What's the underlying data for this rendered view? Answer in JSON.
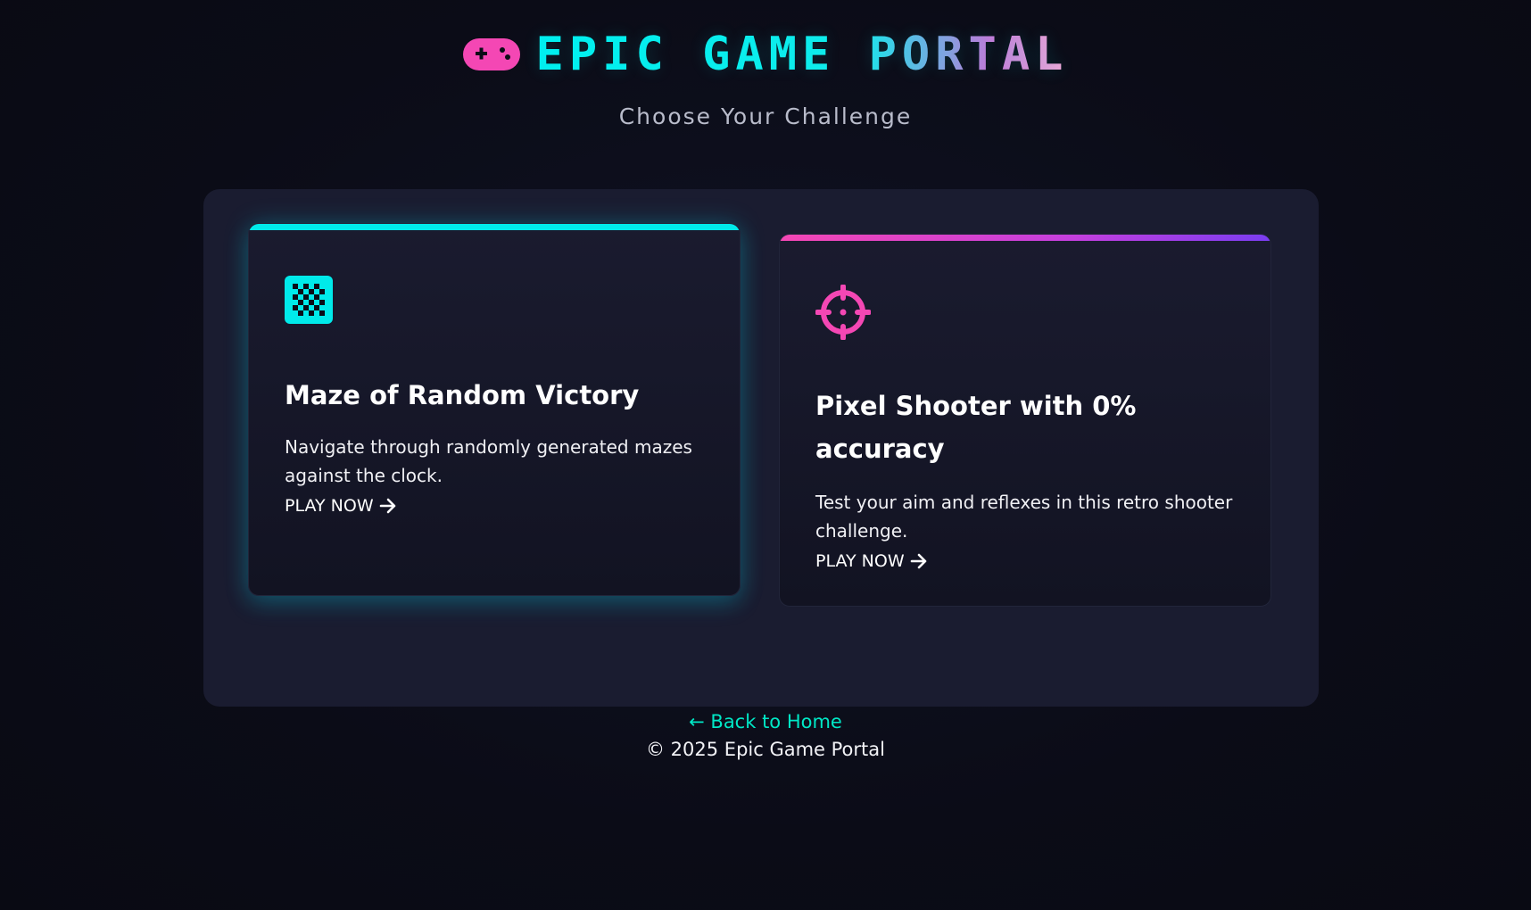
{
  "header": {
    "title": "EPIC GAME PORTAL",
    "subtitle": "Choose Your Challenge",
    "logo_icon": "gamepad-icon"
  },
  "cards": [
    {
      "icon": "checkerboard-icon",
      "title": "Maze of Random Victory",
      "description": "Navigate through randomly generated mazes against the clock.",
      "cta": "PLAY NOW",
      "accent": "#00eaea"
    },
    {
      "icon": "crosshair-icon",
      "title": "Pixel Shooter with 0% accuracy",
      "description": "Test your aim and reflexes in this retro shooter challenge.",
      "cta": "PLAY NOW",
      "accent": "#f447b4"
    }
  ],
  "footer": {
    "back_link": "← Back to Home",
    "copyright": "© 2025 Epic Game Portal"
  },
  "colors": {
    "background": "#0b0c17",
    "panel": "#1a1c30",
    "cyan": "#00eaea",
    "pink": "#f447b4",
    "link": "#00e8c6"
  }
}
